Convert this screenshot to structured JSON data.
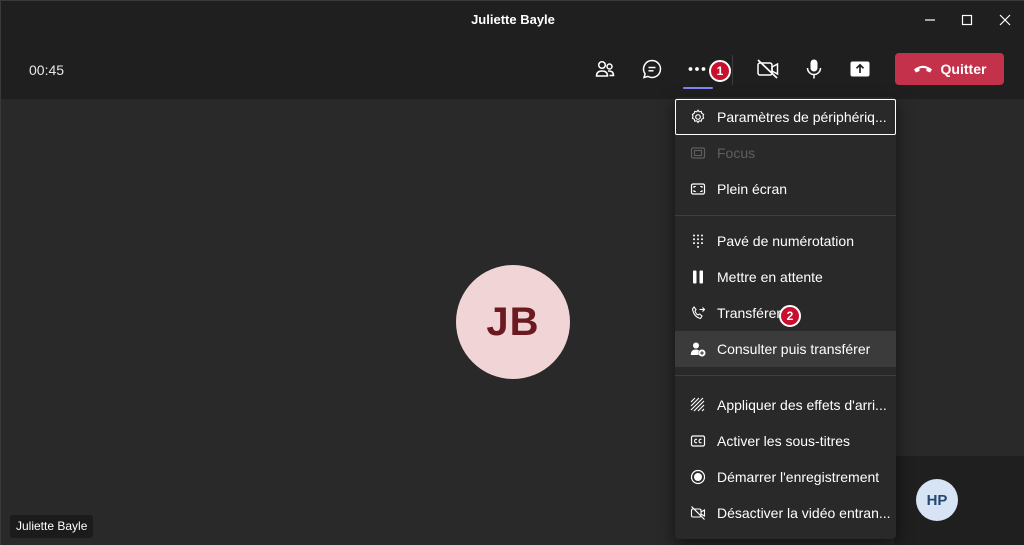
{
  "window": {
    "title": "Juliette Bayle"
  },
  "toolbar": {
    "timer": "00:45",
    "leave_label": "Quitter",
    "colors": {
      "leave": "#c4314b",
      "accent": "#7f85f5"
    }
  },
  "stage": {
    "main_avatar_initials": "JB",
    "participant_name": "Juliette Bayle",
    "self_avatar_initials": "HP"
  },
  "badges": {
    "one": "1",
    "two": "2"
  },
  "menu": {
    "items": [
      {
        "label": "Paramètres de périphériq...",
        "icon": "gear-icon"
      },
      {
        "label": "Focus",
        "icon": "focus-icon"
      },
      {
        "label": "Plein écran",
        "icon": "fullscreen-icon"
      },
      {
        "label": "Pavé de numérotation",
        "icon": "dialpad-icon"
      },
      {
        "label": "Mettre en attente",
        "icon": "pause-icon"
      },
      {
        "label": "Transférer",
        "icon": "transfer-phone-icon"
      },
      {
        "label": "Consulter puis transférer",
        "icon": "consult-transfer-icon"
      },
      {
        "label": "Appliquer des effets d'arri...",
        "icon": "background-effects-icon"
      },
      {
        "label": "Activer les sous-titres",
        "icon": "captions-icon"
      },
      {
        "label": "Démarrer l'enregistrement",
        "icon": "record-icon"
      },
      {
        "label": "Désactiver la vidéo entran...",
        "icon": "video-off-icon"
      }
    ]
  }
}
